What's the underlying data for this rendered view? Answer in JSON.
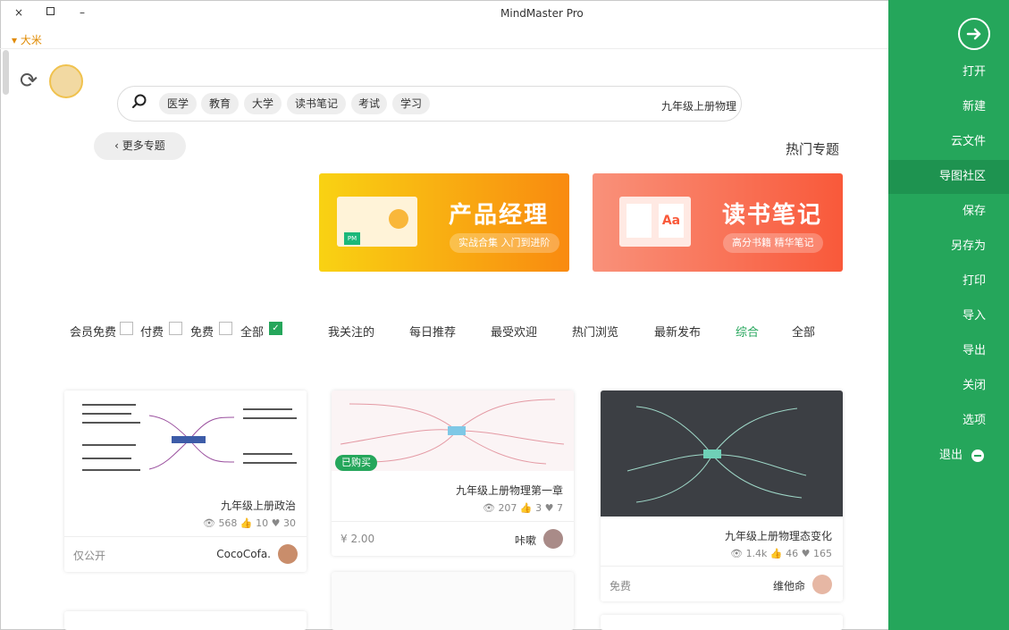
{
  "window": {
    "title": "MindMaster Pro",
    "close": "×",
    "minimize": "–"
  },
  "topbar": {
    "menu": "大米"
  },
  "sidebar": {
    "items": [
      "打开",
      "新建",
      "云文件",
      "导图社区",
      "保存",
      "另存为",
      "打印",
      "导入",
      "导出",
      "关闭",
      "选项",
      "退出"
    ],
    "active_index": 3
  },
  "search": {
    "query": "九年级上册物理",
    "tags": [
      "学习",
      "考试",
      "读书笔记",
      "大学",
      "教育",
      "医学"
    ]
  },
  "topics": {
    "title": "热门专题",
    "more": "更多专题"
  },
  "banners": [
    {
      "title": "读书笔记",
      "subtitle": "高分书籍 精华笔记",
      "badge": "Aa"
    },
    {
      "title": "产品经理",
      "subtitle": "实战合集 入门到进阶",
      "badge": "PM"
    }
  ],
  "tabs": [
    "全部",
    "综合",
    "最新发布",
    "热门浏览",
    "最受欢迎",
    "每日推荐",
    "我关注的"
  ],
  "active_tab": 1,
  "filters": [
    "全部",
    "免费",
    "付费",
    "会员免费"
  ],
  "cards": [
    {
      "title": "九年级上册物理态变化",
      "views": "1.4k",
      "likes": "46",
      "hearts": "165",
      "author": "维他命",
      "price": "免费"
    },
    {
      "title": "九年级上册物理第一章",
      "views": "207",
      "likes": "3",
      "hearts": "7",
      "author": "咔嗽",
      "price": "¥ 2.00",
      "badge": "已购买"
    },
    {
      "title": "九年级上册政治",
      "views": "568",
      "likes": "10",
      "hearts": "30",
      "author": "CocoCofa.",
      "price": "仅公开"
    }
  ],
  "colors": {
    "green": "#25a65b",
    "banner1": "#f9735b",
    "banner2": "#f99a10"
  }
}
